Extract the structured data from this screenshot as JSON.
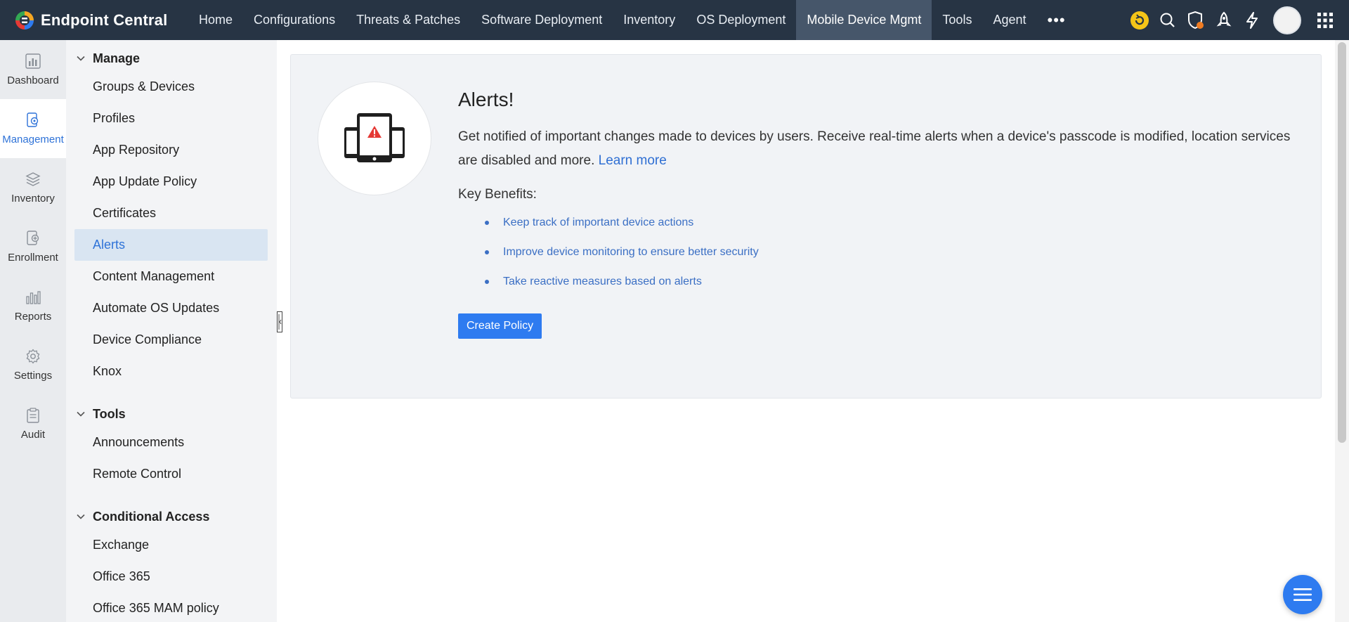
{
  "brand": {
    "name": "Endpoint Central"
  },
  "nav": {
    "items": [
      {
        "label": "Home"
      },
      {
        "label": "Configurations"
      },
      {
        "label": "Threats & Patches"
      },
      {
        "label": "Software Deployment"
      },
      {
        "label": "Inventory"
      },
      {
        "label": "OS Deployment"
      },
      {
        "label": "Mobile Device Mgmt",
        "active": true
      },
      {
        "label": "Tools"
      },
      {
        "label": "Agent"
      }
    ],
    "more": "•••"
  },
  "top_icons": [
    "refresh-icon",
    "search-icon",
    "shield-icon",
    "rocket-icon",
    "lightning-icon",
    "avatar",
    "apps-grid-icon"
  ],
  "rail": {
    "items": [
      {
        "label": "Dashboard",
        "icon": "dashboard-icon"
      },
      {
        "label": "Management",
        "icon": "management-icon",
        "active": true
      },
      {
        "label": "Inventory",
        "icon": "inventory-icon"
      },
      {
        "label": "Enrollment",
        "icon": "enrollment-icon"
      },
      {
        "label": "Reports",
        "icon": "reports-icon"
      },
      {
        "label": "Settings",
        "icon": "settings-icon"
      },
      {
        "label": "Audit",
        "icon": "audit-icon"
      }
    ]
  },
  "subnav": {
    "manage": {
      "title": "Manage",
      "items": [
        "Groups & Devices",
        "Profiles",
        "App Repository",
        "App Update Policy",
        "Certificates",
        "Alerts",
        "Content Management",
        "Automate OS Updates",
        "Device Compliance",
        "Knox"
      ]
    },
    "tools": {
      "title": "Tools",
      "items": [
        "Announcements",
        "Remote Control"
      ]
    },
    "conditional": {
      "title": "Conditional Access",
      "items": [
        "Exchange",
        "Office 365",
        "Office 365 MAM policy"
      ]
    }
  },
  "main": {
    "title": "Alerts!",
    "description": "Get notified of important changes made to devices by users. Receive real-time alerts when a device's passcode is modified, location services are disabled and more.",
    "learn_more": "Learn more",
    "key_benefits_title": "Key Benefits:",
    "benefits": [
      "Keep track of important device actions",
      "Improve device monitoring to ensure better security",
      "Take reactive measures based on alerts"
    ],
    "create_button": "Create Policy"
  },
  "colors": {
    "topbar": "#273444",
    "accent": "#2e7bf0",
    "link": "#2f6fd3",
    "alert_red": "#e53935"
  }
}
